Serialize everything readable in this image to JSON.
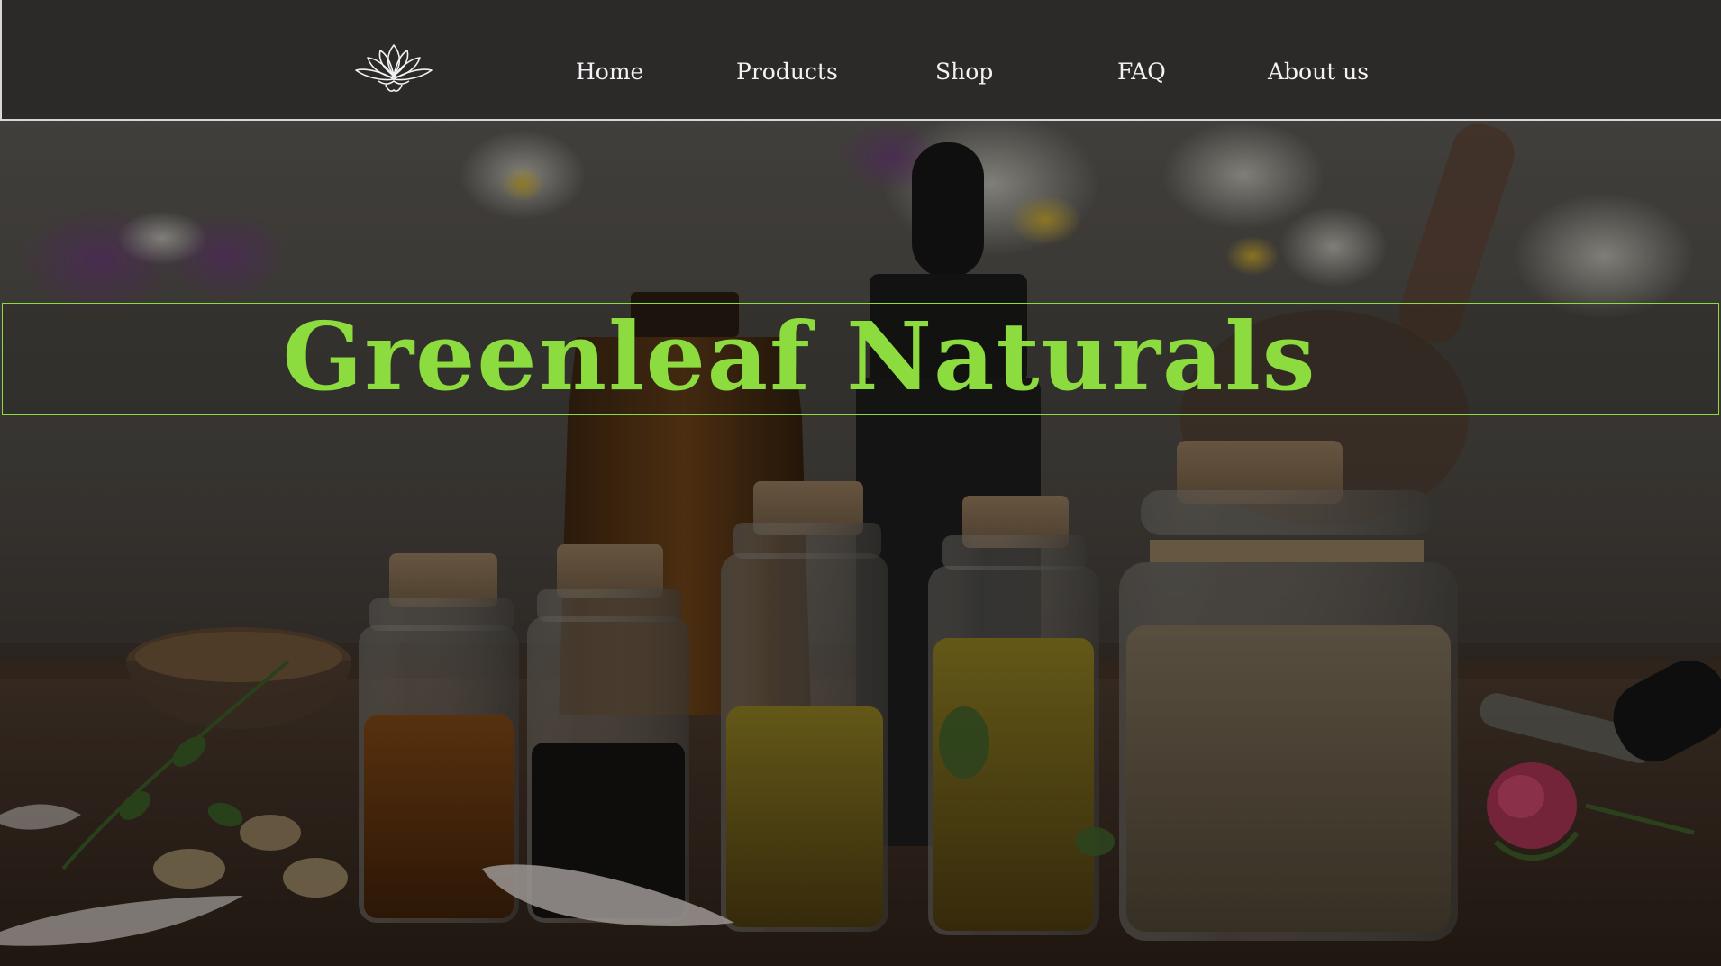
{
  "brand": {
    "logo_icon": "lotus-icon",
    "title": "Greenleaf Naturals",
    "accent_color": "#8ddc3f",
    "nav_background": "#2c2a29"
  },
  "nav": {
    "items": [
      {
        "label": "Home"
      },
      {
        "label": "Products"
      },
      {
        "label": "Shop"
      },
      {
        "label": "FAQ"
      },
      {
        "label": "About us"
      }
    ]
  },
  "hero": {
    "image": "essential-oil-bottles-photo",
    "overlay": "darkened"
  }
}
